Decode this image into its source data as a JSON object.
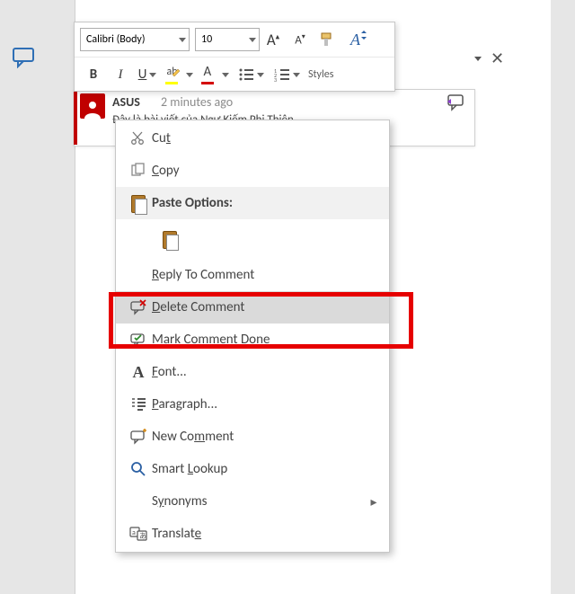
{
  "toolbar": {
    "font_name": "Calibri (Body)",
    "font_size": "10",
    "styles_label": "Styles"
  },
  "comment": {
    "author": "ASUS",
    "time": "2 minutes ago",
    "body": "Đây là bài viết của Ngự Kiếm Phi Thiên"
  },
  "ctx": {
    "cut": "Cut",
    "copy": "Copy",
    "paste_heading": "Paste Options:",
    "reply": "Reply To Comment",
    "delete": "Delete Comment",
    "done": "Mark Comment Done",
    "font": "Font...",
    "paragraph": "Paragraph...",
    "newc": "New Comment",
    "lookup": "Smart Lookup",
    "synonyms": "Synonyms",
    "translate": "Translate"
  }
}
